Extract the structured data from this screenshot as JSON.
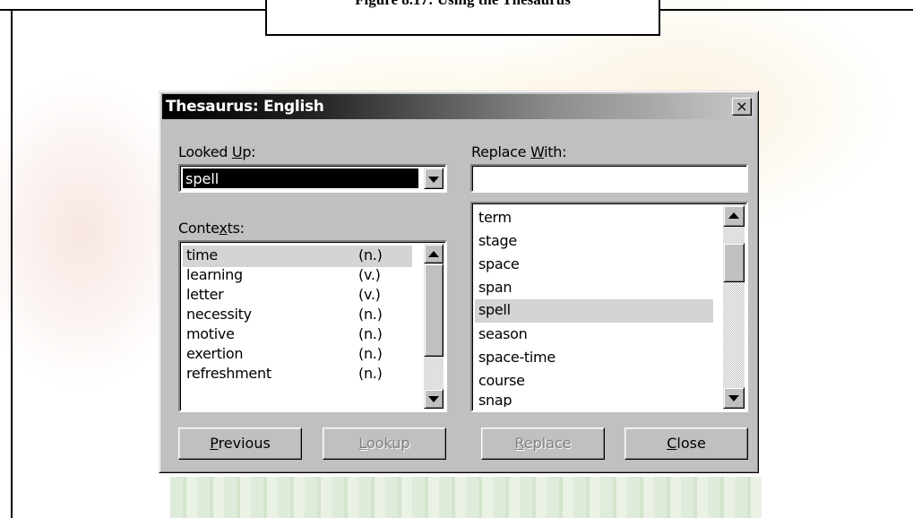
{
  "figure": {
    "caption": "Figure 8.17: Using the Thesaurus"
  },
  "dialog": {
    "title": "Thesaurus: English",
    "close_symbol": "×",
    "looked_up": {
      "label_pre": "Looked ",
      "label_key": "U",
      "label_post": "p:",
      "value": "spell"
    },
    "replace_with": {
      "label_pre": "Replace ",
      "label_key": "W",
      "label_post": "ith:",
      "value": ""
    },
    "contexts": {
      "label_pre": "Conte",
      "label_key": "x",
      "label_post": "ts:",
      "items": [
        {
          "word": "time",
          "pos": "(n.)",
          "selected": true
        },
        {
          "word": "learning",
          "pos": "(v.)"
        },
        {
          "word": "letter",
          "pos": "(v.)"
        },
        {
          "word": "necessity",
          "pos": "(n.)"
        },
        {
          "word": "motive",
          "pos": "(n.)"
        },
        {
          "word": "exertion",
          "pos": "(n.)"
        },
        {
          "word": "refreshment",
          "pos": "(n.)"
        }
      ]
    },
    "synonyms": {
      "items": [
        {
          "word": "term"
        },
        {
          "word": "stage"
        },
        {
          "word": "space"
        },
        {
          "word": "span"
        },
        {
          "word": "spell",
          "selected": true
        },
        {
          "word": "season"
        },
        {
          "word": "space-time"
        },
        {
          "word": "course"
        },
        {
          "word": "snap"
        }
      ]
    },
    "buttons": {
      "previous": {
        "key": "P",
        "rest": "revious",
        "enabled": true
      },
      "lookup": {
        "key": "L",
        "rest": "ookup",
        "enabled": false
      },
      "replace": {
        "key": "R",
        "rest": "eplace",
        "enabled": false
      },
      "close": {
        "key": "C",
        "rest": "lose",
        "enabled": true
      }
    }
  },
  "colors": {
    "face": "#c0c0c0",
    "selection": "#000000",
    "row_highlight": "#d4d4d4"
  },
  "icons": [
    "close-icon",
    "dropdown-arrow-icon",
    "scroll-up-icon",
    "scroll-down-icon"
  ]
}
